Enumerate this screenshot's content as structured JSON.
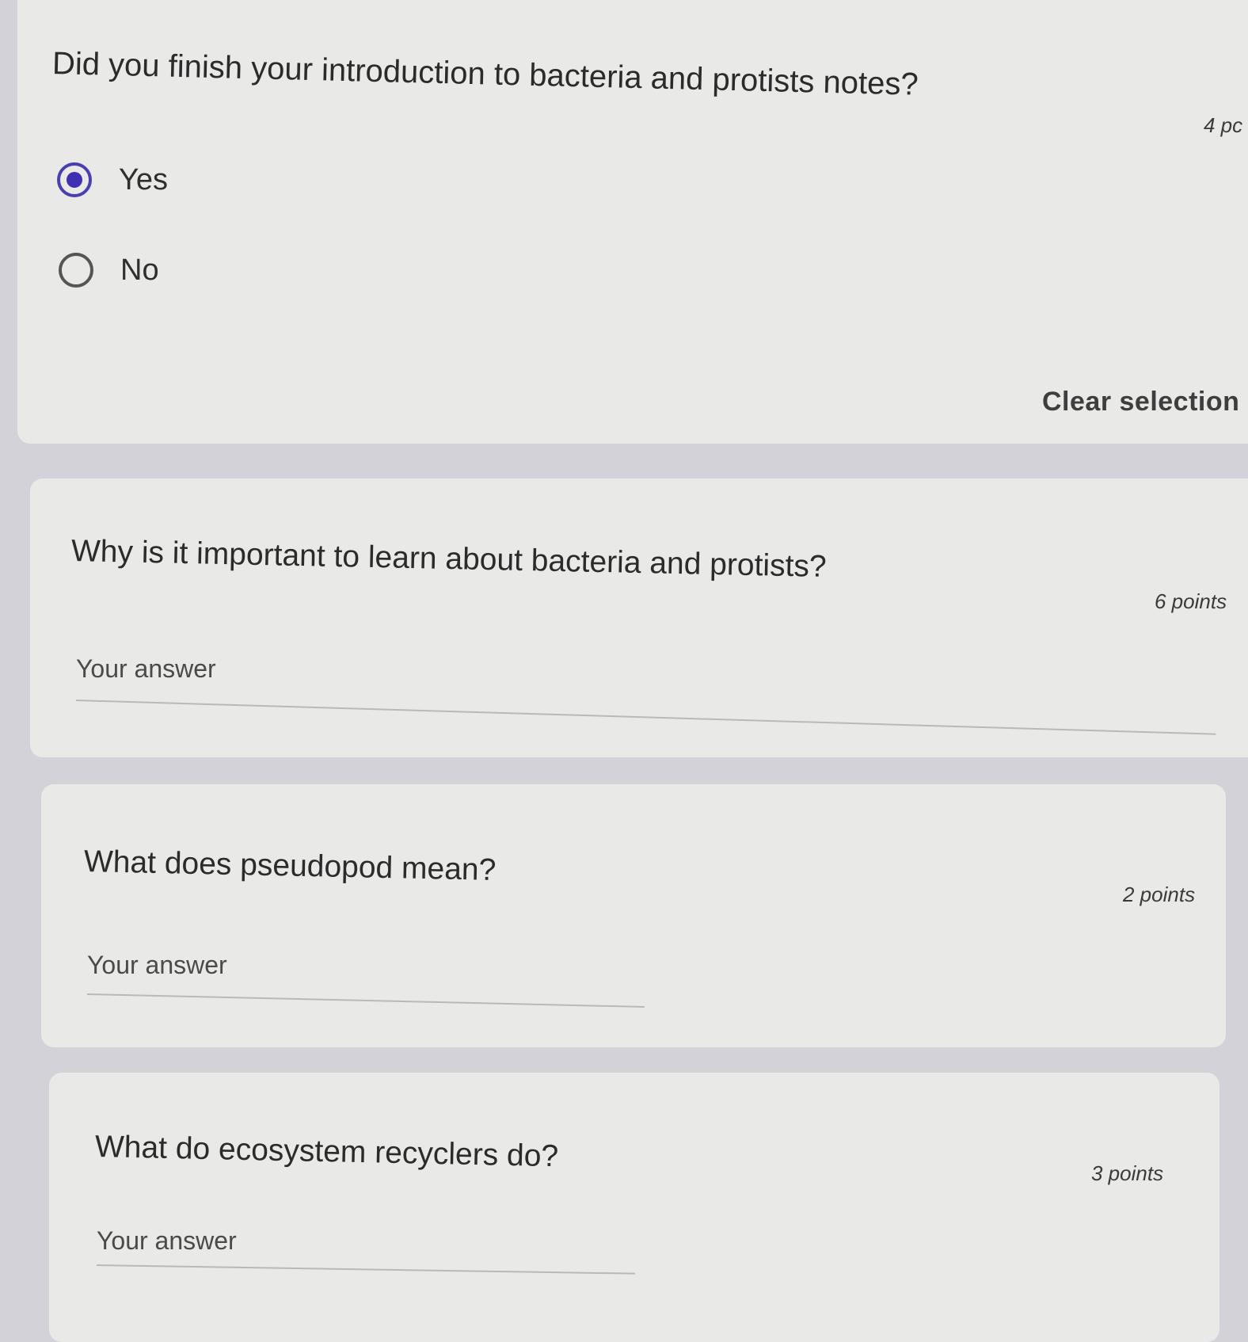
{
  "questions": [
    {
      "title": "Did you finish your introduction to bacteria and protists notes?",
      "points": "4 pc",
      "options": [
        {
          "label": "Yes",
          "selected": true
        },
        {
          "label": "No",
          "selected": false
        }
      ],
      "clear_label": "Clear selection"
    },
    {
      "title": "Why is it important to learn about bacteria and protists?",
      "points": "6 points",
      "placeholder": "Your answer"
    },
    {
      "title": "What does pseudopod mean?",
      "points": "2 points",
      "placeholder": "Your answer"
    },
    {
      "title": "What do ecosystem recyclers do?",
      "points": "3 points",
      "placeholder": "Your answer"
    }
  ],
  "colors": {
    "background": "#d3d2d8",
    "card": "#e9eae7",
    "radio_selected": "#3f2fb3",
    "text": "#2b2b2b"
  }
}
